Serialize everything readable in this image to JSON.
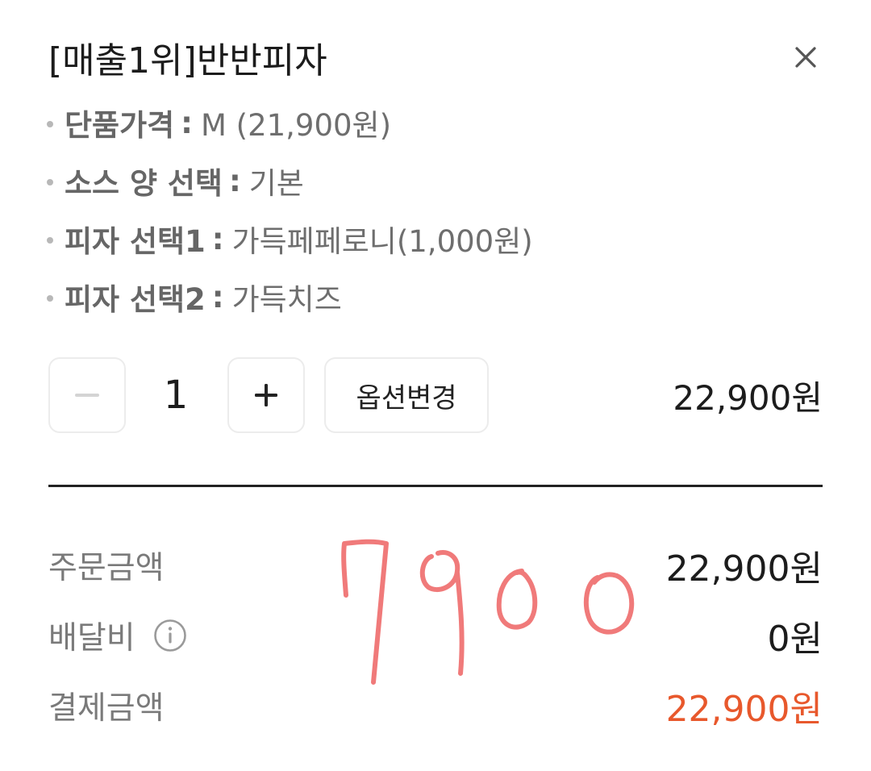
{
  "product": {
    "title": "[매출1위]반반피자"
  },
  "options": [
    {
      "label": "단품가격",
      "sep": ":",
      "value": "M (21,900원)"
    },
    {
      "label": "소스 양 선택",
      "sep": ":",
      "value": "기본"
    },
    {
      "label": "피자 선택1",
      "sep": ":",
      "value": "가득페페로니(1,000원)"
    },
    {
      "label": "피자 선택2",
      "sep": ":",
      "value": "가득치즈"
    }
  ],
  "quantity": {
    "value": "1",
    "change_option_label": "옵션변경",
    "line_price": "22,900원"
  },
  "summary": {
    "order_amount_label": "주문금액",
    "order_amount_value": "22,900원",
    "delivery_fee_label": "배달비",
    "delivery_fee_value": "0원",
    "payment_amount_label": "결제금액",
    "payment_amount_value": "22,900원"
  },
  "handwriting": {
    "text": "7900"
  },
  "icons": {
    "close": "close-icon",
    "minus": "minus-icon",
    "plus": "plus-icon",
    "info": "info-icon"
  },
  "colors": {
    "accent": "#e8582c",
    "scribble": "#f07a7a",
    "muted_text": "#7a7a7a",
    "divider": "#222222",
    "button_border": "#ececec"
  }
}
